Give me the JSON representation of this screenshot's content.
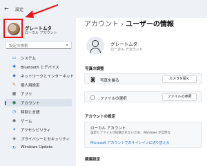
{
  "window": {
    "back_glyph": "←",
    "title": "設定"
  },
  "user": {
    "name": "グレートムタ",
    "type": "ローカル アカウント"
  },
  "search": {
    "placeholder": "設定の検索"
  },
  "nav": {
    "items": [
      {
        "label": "システム",
        "icon": "system-icon",
        "glyph": "▭",
        "color": "#1f6fd1",
        "active": false
      },
      {
        "label": "Bluetooth とデバイス",
        "icon": "bluetooth-icon",
        "glyph": "✱",
        "color": "#1f6fd1",
        "active": false
      },
      {
        "label": "ネットワークとインターネット",
        "icon": "network-icon",
        "glyph": "◆",
        "color": "#4a6fa5",
        "active": false
      },
      {
        "label": "個人用設定",
        "icon": "personalization-icon",
        "glyph": "✎",
        "color": "#d2691e",
        "active": false
      },
      {
        "label": "アプリ",
        "icon": "apps-icon",
        "glyph": "▦",
        "color": "#555555",
        "active": false
      },
      {
        "label": "アカウント",
        "icon": "accounts-icon",
        "glyph": "●",
        "color": "#2e8b57",
        "active": true
      },
      {
        "label": "時刻と言語",
        "icon": "time-language-icon",
        "glyph": "◷",
        "color": "#1f6fd1",
        "active": false
      },
      {
        "label": "ゲーム",
        "icon": "gaming-icon",
        "glyph": "◉",
        "color": "#555555",
        "active": false
      },
      {
        "label": "アクセシビリティ",
        "icon": "accessibility-icon",
        "glyph": "✦",
        "color": "#1f6fd1",
        "active": false
      },
      {
        "label": "プライバシーとセキュリティ",
        "icon": "privacy-icon",
        "glyph": "◈",
        "color": "#555555",
        "active": false
      },
      {
        "label": "Windows Update",
        "icon": "windows-update-icon",
        "glyph": "↻",
        "color": "#1f6fd1",
        "active": false
      }
    ]
  },
  "main": {
    "breadcrumb_parent": "アカウント",
    "breadcrumb_sep": "›",
    "breadcrumb_current": "ユーザーの情報",
    "user_name": "グレートムタ",
    "user_type": "ローカル アカウント",
    "photo_section_title": "写真の調整",
    "photo_rows": [
      {
        "label": "写真を撮る",
        "button": "カメラを開く",
        "icon": "camera-icon",
        "glyph": "◙"
      },
      {
        "label": "ファイルの選択",
        "button": "ファイルの参照",
        "icon": "file-icon",
        "glyph": "▢"
      }
    ],
    "account_section_title": "アカウントの設定",
    "account_card": {
      "title": "ローカル アカウント",
      "description": "設定とファイルが同期されないため、Windows が自然な",
      "link": "Microsoft アカウントでのサインインに切り替える"
    },
    "related_title": "関連設定"
  },
  "annotation": {
    "highlight_color": "#e8141a"
  }
}
